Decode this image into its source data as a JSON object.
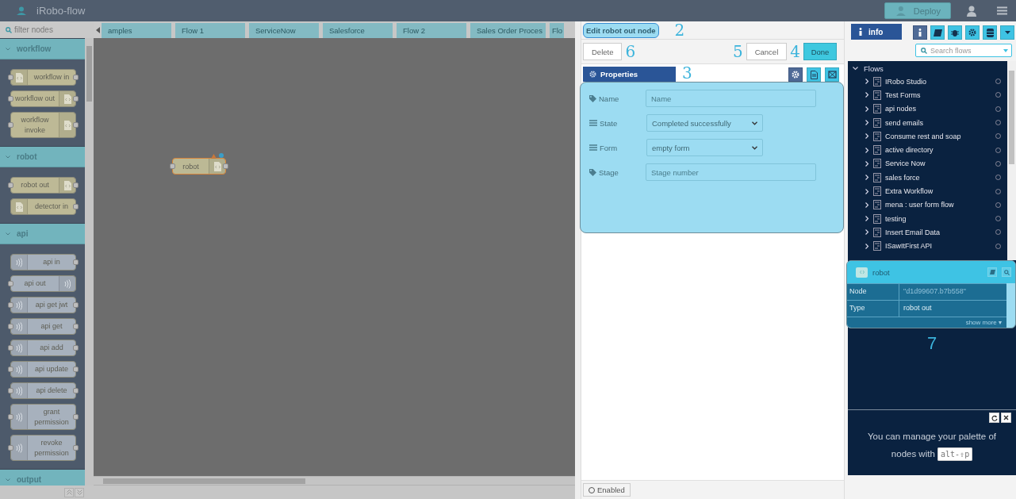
{
  "header": {
    "title": "iRobo-flow",
    "deploy": "Deploy"
  },
  "palette": {
    "filter_placeholder": "filter nodes",
    "categories": [
      {
        "name": "workflow",
        "expanded": true,
        "nodes": [
          {
            "label": "workflow in",
            "kind": "source",
            "input": true,
            "output": true
          },
          {
            "label": "workflow out",
            "kind": "sink",
            "input": true,
            "output": true
          },
          {
            "label": "workflow invoke",
            "kind": "sink",
            "input": true,
            "output": true
          }
        ]
      },
      {
        "name": "robot",
        "expanded": true,
        "nodes": [
          {
            "label": "robot out",
            "kind": "sink",
            "input": true,
            "output": true
          },
          {
            "label": "detector in",
            "kind": "source",
            "input": false,
            "output": true
          }
        ]
      },
      {
        "name": "api",
        "expanded": true,
        "nodes": [
          {
            "label": "api in",
            "kind": "source",
            "input": false,
            "output": true
          },
          {
            "label": "api out",
            "kind": "sink",
            "input": true,
            "output": false
          },
          {
            "label": "api get jwt",
            "kind": "source",
            "input": true,
            "output": true
          },
          {
            "label": "api get",
            "kind": "source",
            "input": true,
            "output": true
          },
          {
            "label": "api add",
            "kind": "source",
            "input": true,
            "output": true
          },
          {
            "label": "api update",
            "kind": "source",
            "input": true,
            "output": true
          },
          {
            "label": "api delete",
            "kind": "source",
            "input": true,
            "output": true
          },
          {
            "label": "grant permission",
            "kind": "source",
            "input": true,
            "output": true
          },
          {
            "label": "revoke permission",
            "kind": "source",
            "input": true,
            "output": true
          }
        ]
      },
      {
        "name": "output",
        "expanded": true
      }
    ]
  },
  "workspace": {
    "tabs": [
      {
        "label": "amples",
        "selected": false
      },
      {
        "label": "Flow 1",
        "selected": false
      },
      {
        "label": "ServiceNow",
        "selected": false
      },
      {
        "label": "Salesforce",
        "selected": false
      },
      {
        "label": "Flow 2",
        "selected": false
      },
      {
        "label": "Sales Order Proces",
        "selected": false
      },
      {
        "label": "Flo",
        "selected": false
      }
    ],
    "nodes": [
      {
        "label": "robot",
        "changed": true,
        "warning": true
      }
    ]
  },
  "editor": {
    "title": "Edit robot out node",
    "title_annotation": "2",
    "buttons": [
      {
        "label": "Delete",
        "kind": "plain",
        "annotation": "6"
      },
      {
        "label": "Cancel",
        "kind": "plain",
        "annotation": "5"
      },
      {
        "label": "Done",
        "kind": "primary",
        "annotation": "4"
      }
    ],
    "tab": {
      "label": "Properties",
      "annotation": "3"
    },
    "fields": [
      {
        "label": "Name",
        "kind": "text",
        "placeholder": "Name"
      },
      {
        "label": "State",
        "kind": "select",
        "value": "Completed successfully"
      },
      {
        "label": "Form",
        "kind": "select",
        "value": "empty form"
      },
      {
        "label": "Stage",
        "kind": "text",
        "placeholder": "Stage number"
      }
    ],
    "enabled": {
      "label": "Enabled",
      "on": false
    }
  },
  "sidebar": {
    "tab": "info",
    "tools": [
      {
        "kind": "info",
        "selected": true
      },
      {
        "kind": "book",
        "selected": false
      },
      {
        "kind": "bug",
        "selected": false
      },
      {
        "kind": "gear",
        "selected": false
      },
      {
        "kind": "database",
        "selected": false
      },
      {
        "kind": "caret",
        "selected": false
      }
    ],
    "search_placeholder": "Search flows",
    "tree": {
      "label": "Flows",
      "expanded": true,
      "children": [
        {
          "label": "IRobo Studio",
          "expanded": false
        },
        {
          "label": "Test Forms",
          "expanded": false
        },
        {
          "label": "api nodes",
          "expanded": false
        },
        {
          "label": "send emails",
          "expanded": false
        },
        {
          "label": "Consume rest and soap",
          "expanded": false
        },
        {
          "label": "active directory",
          "expanded": false
        },
        {
          "label": "Service Now",
          "expanded": false
        },
        {
          "label": "sales force",
          "expanded": false
        },
        {
          "label": "Extra Workflow",
          "expanded": false
        },
        {
          "label": "mena : user form flow",
          "expanded": false
        },
        {
          "label": "testing",
          "expanded": false
        },
        {
          "label": "Insert Email Data",
          "expanded": false
        },
        {
          "label": "ISawItFirst API",
          "expanded": false
        }
      ]
    },
    "node_info": {
      "title": "robot",
      "rows": [
        {
          "key": "Node",
          "value": "\"d1d99607.b7b558\"",
          "muted": true
        },
        {
          "key": "Type",
          "value": "robot out",
          "muted": false
        }
      ],
      "show_more": "show more ▾",
      "annotation": "7"
    },
    "help": {
      "text": "You can manage your palette of nodes with",
      "shortcut": "alt-⇧p"
    }
  }
}
